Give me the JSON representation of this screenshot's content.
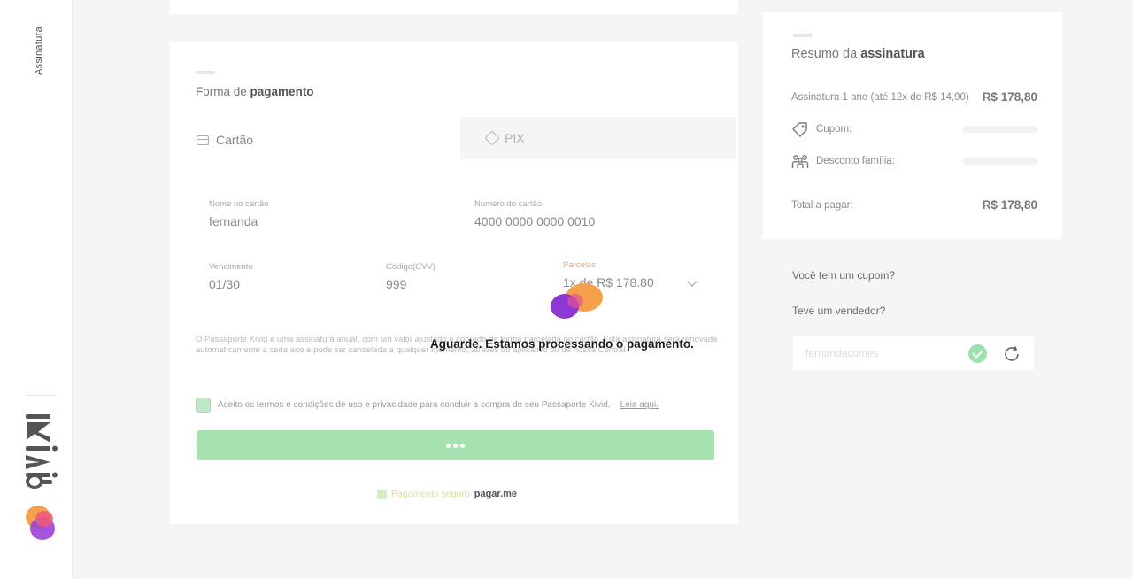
{
  "sidebar": {
    "nav_label": "Assinatura",
    "brand": "kivid"
  },
  "payment": {
    "title_prefix": "Forma de",
    "title_strong": "pagamento",
    "tabs": [
      {
        "label": "Cartão"
      },
      {
        "label": "PIX"
      }
    ],
    "fields": {
      "card_name": {
        "label": "Nome no cartão",
        "value": "fernanda"
      },
      "card_number": {
        "label": "Numero do cartão",
        "value": "4000 0000 0000 0010"
      },
      "expiry": {
        "label": "Vencimento",
        "value": "01/30"
      },
      "cvv": {
        "label": "Código(CVV)",
        "value": "999"
      },
      "installments": {
        "label": "Parcelas",
        "value": "1x de R$ 178.80"
      }
    },
    "legal_text": "O Passaporte Kivid é uma assinatura anual, com um valor ajustado e cobrado de forma parcelada no cartão. Esta assinatura será renovada automaticamente a cada ano e pode ser cancelada a qualquer momento, através do aplicativo ou de nossa Central",
    "terms_text": "Aceito os termos e condições de uso e privacidade para concluir a compra do seu Passaporte Kivid.",
    "terms_link": "Leia aqui.",
    "terms_checked": true,
    "secure_text": "Pagamento seguro",
    "gateway_logo": "pagar.me"
  },
  "summary": {
    "title_prefix": "Resumo da",
    "title_strong": "assinatura",
    "subscription_label": "Assinatura 1 ano (até 12x de R$ 14,90)",
    "subscription_value": "R$ 178,80",
    "coupon_label": "Cupom:",
    "family_label": "Desconto família:",
    "total_label": "Total a pagar:",
    "total_value": "R$ 178,80"
  },
  "extras": {
    "coupon_question": "Você tem um cupom?",
    "seller_question": "Teve um vendedor?",
    "seller_value": "fernandacomes"
  },
  "overlay": {
    "message": "Aguarde. Estamos processando o pagamento."
  },
  "colors": {
    "success_green": "#a6e2b0",
    "brand_orange": "#f39a4b",
    "brand_purple": "#8f3fd6"
  }
}
